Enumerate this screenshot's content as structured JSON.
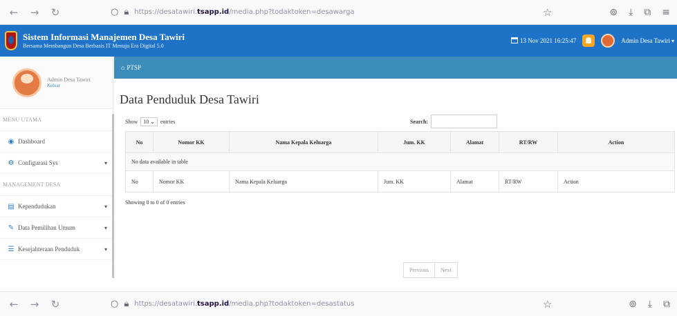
{
  "browser": {
    "url_prefix": "https://desatawiri.",
    "url_domain": "tsapp.id",
    "url_suffix": "/media.php?todaktoken=desawarga",
    "bottom_url_prefix": "https://desatawiri.",
    "bottom_url_domain": "tsapp.id",
    "bottom_url_suffix": "/media.php?todaktoken=desastatus"
  },
  "header": {
    "title": "Sistem Informasi Manajemen Desa Tawiri",
    "subtitle": "Bersama Membangun Desa Berbasis IT Menuju Era Digital 5.0",
    "datetime": "13 Nov 2021 16:25:47",
    "user": "Admin Desa Tawiri"
  },
  "sidebar": {
    "user_name": "Admin Desa Tawiri",
    "user_status": "Keluar",
    "menu_header_1": "MENU UTAMA",
    "menu_header_2": "MANAGEMENT DESA",
    "items": [
      {
        "label": "Dashboard",
        "icon": "dashboard-icon"
      },
      {
        "label": "Configurasi Sys",
        "icon": "cogs-icon"
      },
      {
        "label": "Kependudukan",
        "icon": "table-icon"
      },
      {
        "label": "Data Pemilihan Umum",
        "icon": "edit-icon"
      },
      {
        "label": "Kesejahteraan Penduduk",
        "icon": "list-icon"
      }
    ]
  },
  "breadcrumb": {
    "label": "PTSP"
  },
  "panel": {
    "title": "Data Penduduk Desa Tawiri",
    "show_label": "Show",
    "entries_value": "10",
    "entries_label": "entries",
    "search_label": "Search:",
    "columns": [
      "No",
      "Nomor KK",
      "Nama Kepala Keluarga",
      "Jum. KK",
      "Alamat",
      "RT/RW",
      "Action"
    ],
    "empty_text": "No data available in table",
    "info": "Showing 0 to 0 of 0 entries",
    "prev_label": "Previous",
    "next_label": "Next"
  }
}
